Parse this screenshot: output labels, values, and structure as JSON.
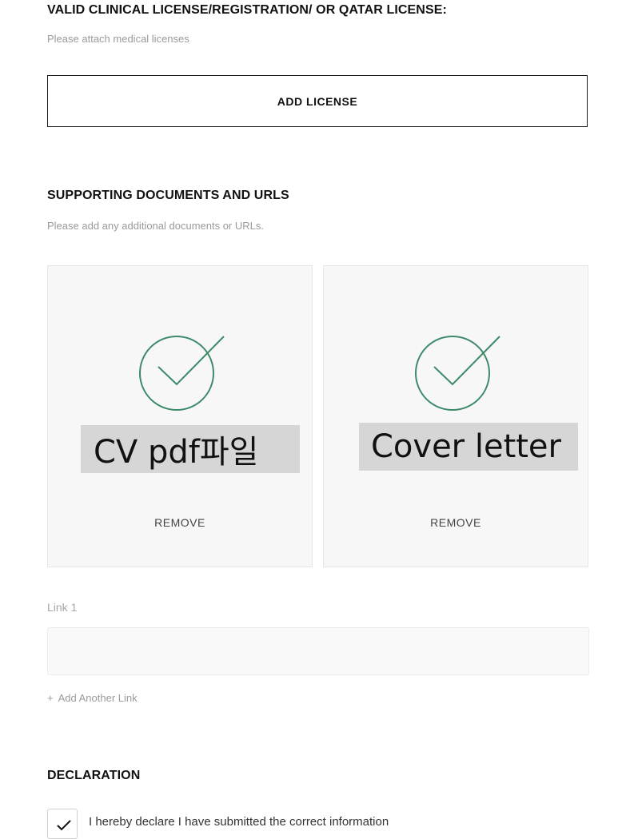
{
  "license_section": {
    "title": "VALID CLINICAL LICENSE/REGISTRATION/ OR QATAR LICENSE:",
    "hint": "Please attach medical licenses",
    "add_button": "ADD LICENSE"
  },
  "supporting_section": {
    "title": "SUPPORTING DOCUMENTS AND URLS",
    "hint": "Please add any additional documents or URLs.",
    "documents": [
      {
        "label": "CV pdf파일",
        "remove_label": "REMOVE"
      },
      {
        "label": "Cover letter",
        "remove_label": "REMOVE"
      }
    ],
    "link_label": "Link 1",
    "link_value": "",
    "link_placeholder": "",
    "add_link_plus": "+",
    "add_link_label": "Add Another Link"
  },
  "declaration": {
    "title": "DECLARATION",
    "checkbox_checked": true,
    "text": "I hereby declare I have submitted the correct information"
  },
  "colors": {
    "check_green": "#3d8a6a",
    "label_highlight": "#d6d6d6",
    "card_background": "#f7f7f7"
  },
  "icons": {
    "upload_done": "check-circle-icon",
    "declaration_check": "checkmark-icon"
  }
}
